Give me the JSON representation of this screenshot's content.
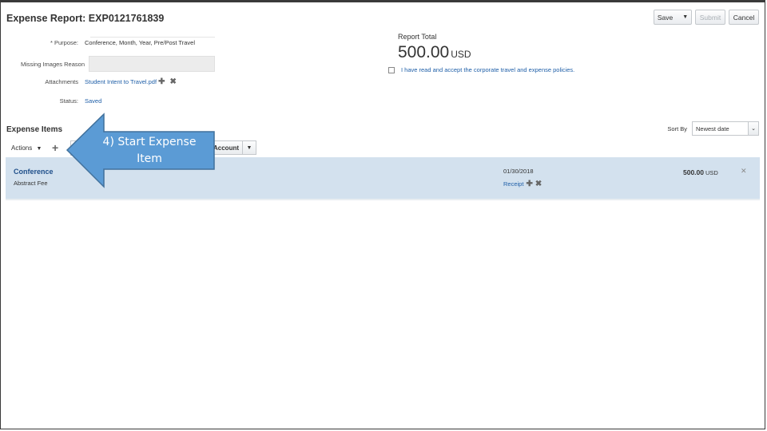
{
  "page": {
    "title": "Expense Report: EXP0121761839"
  },
  "header_buttons": {
    "save": "Save",
    "submit": "Submit",
    "cancel": "Cancel"
  },
  "form": {
    "purpose_label": "* Purpose:",
    "purpose_value": "Conference, Month, Year, Pre/Post Travel",
    "missing_images_label": "Missing Images Reason",
    "missing_images_value": "",
    "attachments_label": "Attachments",
    "attachment_file": "Student Intent to Travel.pdf",
    "status_label": "Status:",
    "status_value": "Saved"
  },
  "report_total": {
    "label": "Report Total",
    "amount": "500.00",
    "currency": "USD",
    "policy_text": "I have read and accept the corporate travel and expense policies."
  },
  "expense_items": {
    "section_title": "Expense Items",
    "actions_label": "Actions",
    "account_button": "Account",
    "sort_by_label": "Sort By",
    "sort_by_value": "Newest date",
    "items": [
      {
        "name": "Conference",
        "subtitle": "Abstract Fee",
        "date": "01/30/2018",
        "receipt_label": "Receipt",
        "amount": "500.00",
        "currency": "USD"
      }
    ]
  },
  "callout": {
    "line1": "4) Start Expense",
    "line2": "Item",
    "fill_color": "#5b9bd5",
    "stroke_color": "#41719c"
  }
}
